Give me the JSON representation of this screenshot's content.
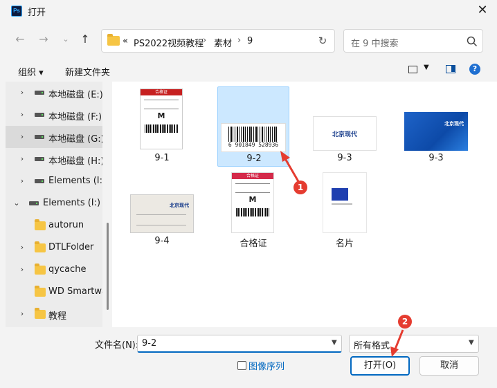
{
  "window": {
    "title": "打开",
    "app_icon": "Ps"
  },
  "nav": {
    "breadcrumb": [
      "«",
      "PS2022视频教程",
      "素材",
      "9"
    ],
    "search_placeholder": "在 9 中搜索"
  },
  "toolbar": {
    "organize": "组织 ▾",
    "new_folder": "新建文件夹",
    "help": "?"
  },
  "sidebar": {
    "items": [
      {
        "label": "本地磁盘 (E:)",
        "type": "drive"
      },
      {
        "label": "本地磁盘 (F:)",
        "type": "drive"
      },
      {
        "label": "本地磁盘 (G:)",
        "type": "drive",
        "selected": true
      },
      {
        "label": "本地磁盘 (H:)",
        "type": "drive"
      },
      {
        "label": "Elements (I:)",
        "type": "drive"
      },
      {
        "label": "Elements (I:)",
        "type": "drive",
        "expanded": true
      },
      {
        "label": "autorun",
        "type": "folder"
      },
      {
        "label": "DTLFolder",
        "type": "folder"
      },
      {
        "label": "qycache",
        "type": "folder"
      },
      {
        "label": "WD Smartwa",
        "type": "folder"
      },
      {
        "label": "教程",
        "type": "folder"
      }
    ]
  },
  "files": [
    {
      "label": "9-1",
      "thumb_text": "合格证",
      "thumb_size": "M"
    },
    {
      "label": "9-2",
      "thumb_text": "6 901849 528936",
      "selected": true
    },
    {
      "label": "9-3",
      "thumb_text": "北京现代"
    },
    {
      "label": "9-3",
      "thumb_text": "北京现代"
    },
    {
      "label": "9-4",
      "thumb_text": "北京现代"
    },
    {
      "label": "合格证",
      "thumb_text": "合格证",
      "thumb_size": "M"
    },
    {
      "label": "名片"
    }
  ],
  "footer": {
    "filename_label": "文件名(N):",
    "filename_value": "9-2",
    "filetype_value": "所有格式",
    "sequence_label": "图像序列",
    "open_button": "打开(O)",
    "cancel_button": "取消"
  },
  "annotations": [
    "1",
    "2"
  ],
  "colors": {
    "accent": "#0067c0",
    "selected_bg": "#cce8ff",
    "annotation": "#e53c30"
  }
}
